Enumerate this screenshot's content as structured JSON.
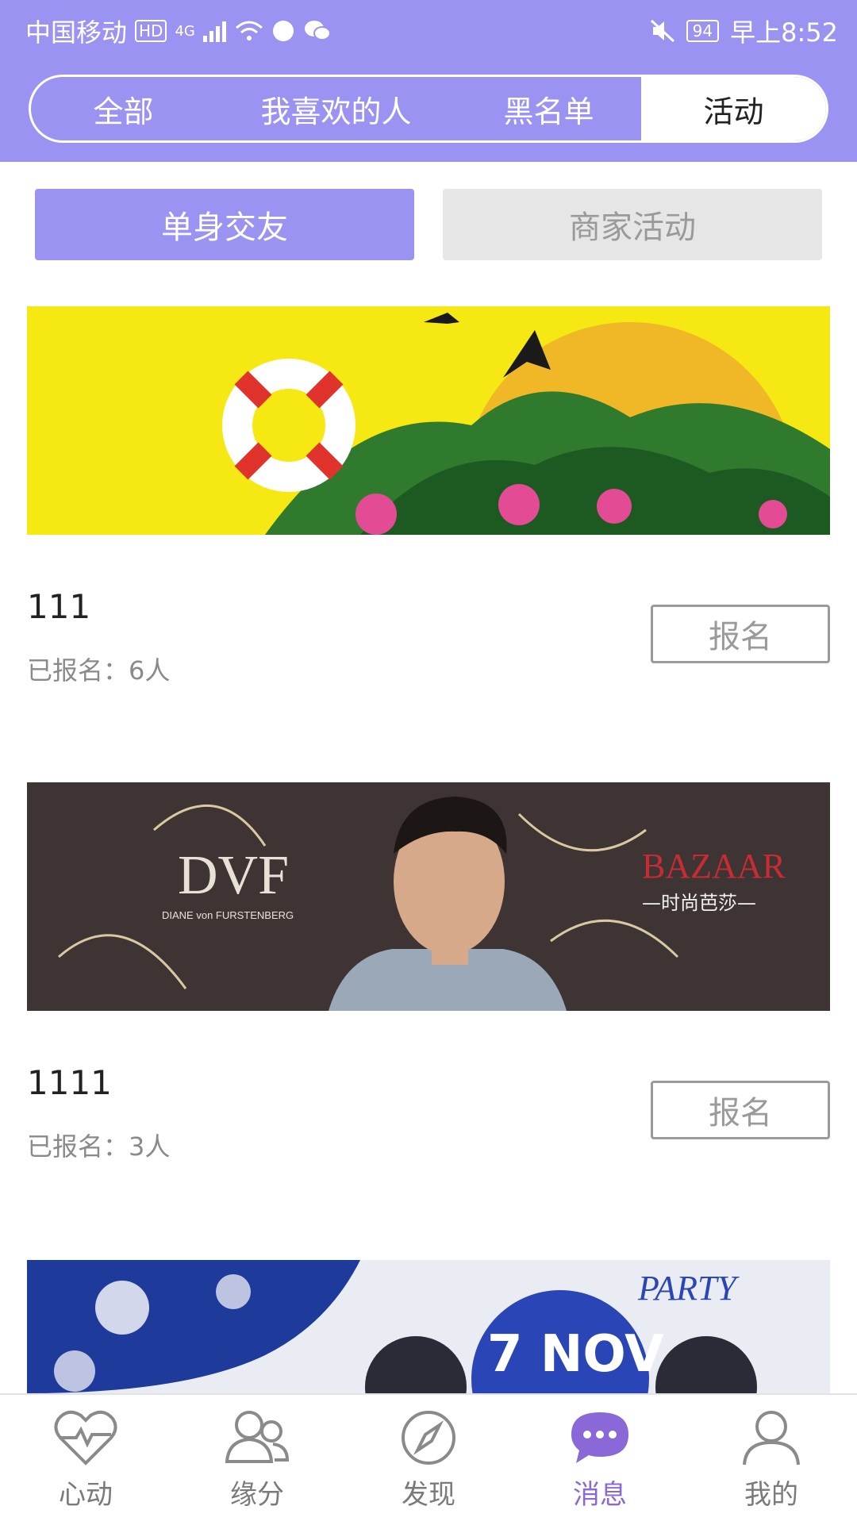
{
  "status_bar": {
    "carrier": "中国移动",
    "hd": "HD",
    "network": "4G",
    "battery": "94",
    "time": "早上8:52"
  },
  "top_tabs": [
    {
      "label": "全部",
      "active": false
    },
    {
      "label": "我喜欢的人",
      "active": false
    },
    {
      "label": "黑名单",
      "active": false
    },
    {
      "label": "活动",
      "active": true
    }
  ],
  "sub_tabs": {
    "single": "单身交友",
    "merchant": "商家活动"
  },
  "activities": [
    {
      "title": "111",
      "count_text": "已报名：6人",
      "button": "报名"
    },
    {
      "title": "1111",
      "count_text": "已报名：3人",
      "button": "报名"
    }
  ],
  "banner3": {
    "text_party": "PARTY",
    "text_date": "7 NOV"
  },
  "bottom_nav": [
    {
      "label": "心动",
      "icon": "heart-pulse-icon",
      "active": false
    },
    {
      "label": "缘分",
      "icon": "people-icon",
      "active": false
    },
    {
      "label": "发现",
      "icon": "compass-icon",
      "active": false
    },
    {
      "label": "消息",
      "icon": "chat-bubble-icon",
      "active": true
    },
    {
      "label": "我的",
      "icon": "person-icon",
      "active": false
    }
  ],
  "colors": {
    "primary": "#9b93f2",
    "active_nav": "#8a68d8"
  }
}
